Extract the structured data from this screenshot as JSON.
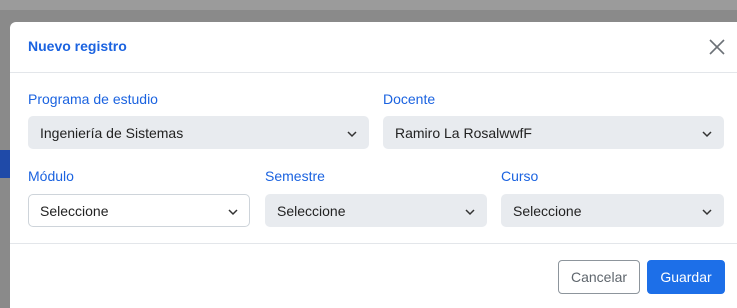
{
  "modal": {
    "title": "Nuevo registro"
  },
  "fields": {
    "programa": {
      "label": "Programa de estudio",
      "value": "Ingeniería de Sistemas"
    },
    "docente": {
      "label": "Docente",
      "value": "Ramiro La RosalwwfF"
    },
    "modulo": {
      "label": "Módulo",
      "value": "Seleccione"
    },
    "semestre": {
      "label": "Semestre",
      "value": "Seleccione"
    },
    "curso": {
      "label": "Curso",
      "value": "Seleccione"
    }
  },
  "footer": {
    "cancel_label": "Cancelar",
    "save_label": "Guardar"
  },
  "colors": {
    "accent": "#1b63e0",
    "primary_button": "#1d6fe8",
    "select_filled_bg": "#e8ebef"
  },
  "icons": {
    "close": "close-icon",
    "chevron": "chevron-down-icon"
  }
}
